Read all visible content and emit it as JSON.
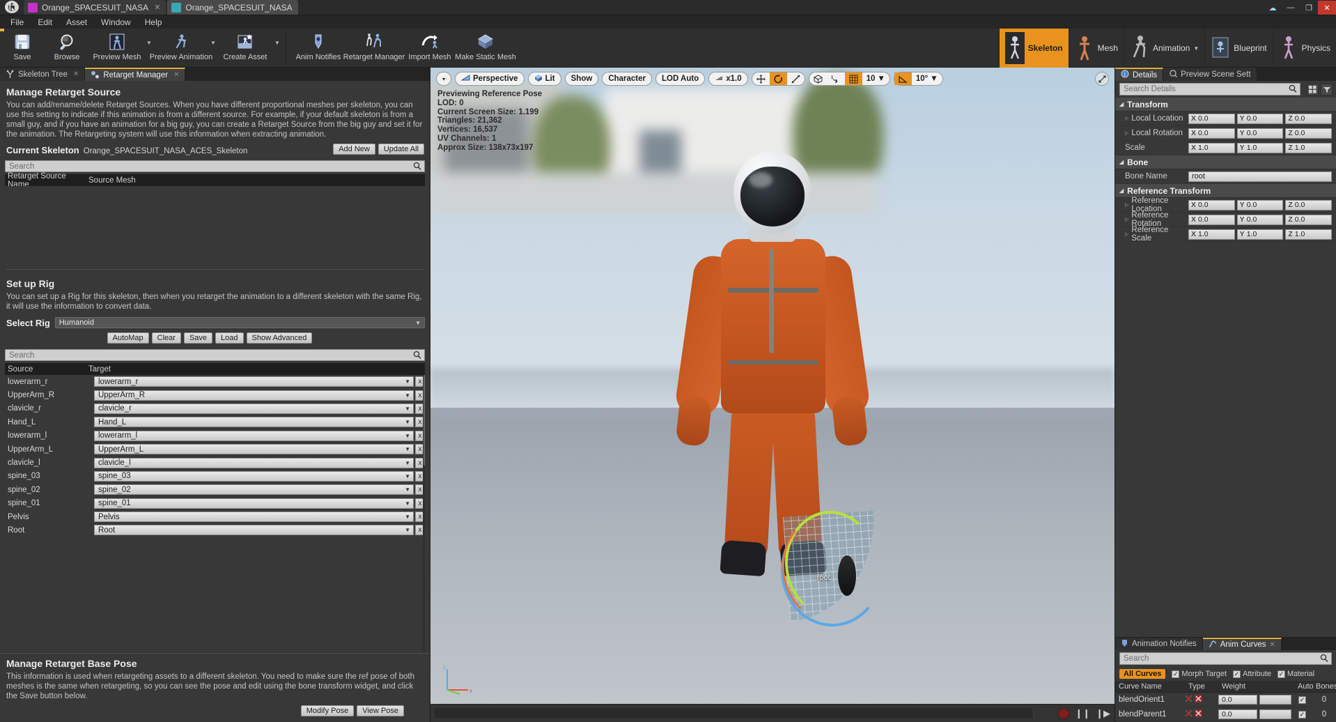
{
  "window": {
    "tabs": [
      {
        "label": "Orange_SPACESUIT_NASA",
        "icon": "skeleton-asset-icon",
        "active": false,
        "color": "#c930c9"
      },
      {
        "label": "Orange_SPACESUIT_NASA",
        "icon": "skeleton-asset-icon",
        "active": true,
        "color": "#3aa7b5"
      }
    ],
    "controls": {
      "minimize": "—",
      "maximize": "❐",
      "close": "✕",
      "extra": "☁"
    }
  },
  "menu": {
    "items": [
      "File",
      "Edit",
      "Asset",
      "Window",
      "Help"
    ]
  },
  "toolbar": {
    "groups": [
      {
        "buttons": [
          {
            "label": "Save",
            "icon": "save-icon",
            "caret": false
          },
          {
            "label": "Browse",
            "icon": "browse-magnifier-icon",
            "caret": false
          },
          {
            "label": "Preview Mesh",
            "icon": "preview-mesh-icon",
            "caret": true
          },
          {
            "label": "Preview Animation",
            "icon": "preview-animation-icon",
            "caret": true
          },
          {
            "label": "Create Asset",
            "icon": "create-asset-icon",
            "caret": true
          }
        ]
      },
      {
        "buttons": [
          {
            "label": "Anim Notifies",
            "icon": "anim-notifies-icon",
            "caret": false
          },
          {
            "label": "Retarget Manager",
            "icon": "retarget-manager-icon",
            "caret": false
          },
          {
            "label": "Import Mesh",
            "icon": "import-mesh-icon",
            "caret": false
          },
          {
            "label": "Make Static Mesh",
            "icon": "make-static-mesh-icon",
            "caret": false
          }
        ]
      }
    ],
    "modes": [
      {
        "label": "Skeleton",
        "icon": "skeleton-mode-icon",
        "active": true,
        "caret": false
      },
      {
        "label": "Mesh",
        "icon": "mesh-mode-icon",
        "active": false,
        "caret": false
      },
      {
        "label": "Animation",
        "icon": "animation-mode-icon",
        "active": false,
        "caret": true
      },
      {
        "label": "Blueprint",
        "icon": "blueprint-mode-icon",
        "active": false,
        "caret": false
      },
      {
        "label": "Physics",
        "icon": "physics-mode-icon",
        "active": false,
        "caret": false
      }
    ]
  },
  "left_panel": {
    "tabs": [
      {
        "label": "Skeleton Tree",
        "icon": "skeleton-tree-icon",
        "active": false,
        "closable": true
      },
      {
        "label": "Retarget Manager",
        "icon": "retarget-manager-tab-icon",
        "active": true,
        "closable": true
      }
    ],
    "manage_retarget_source": {
      "title": "Manage Retarget Source",
      "description": "You can add/rename/delete Retarget Sources. When you have different proportional meshes per skeleton, you can use this setting to indicate if this animation is from a different source. For example, if your default skeleton is from a small guy, and if you have an animation for a big guy, you can create a Retarget Source from the big guy and set it for the animation. The Retargeting system will use this information when extracting animation.",
      "current_skeleton_label": "Current Skeleton",
      "current_skeleton_value": "Orange_SPACESUIT_NASA_ACES_Skeleton",
      "add_new_label": "Add New",
      "update_all_label": "Update All",
      "search_placeholder": "Search",
      "columns": [
        "Retarget Source Name",
        "Source Mesh"
      ],
      "rows": []
    },
    "set_up_rig": {
      "title": "Set up Rig",
      "description": "You can set up a Rig for this skeleton, then when you retarget the animation to a different skeleton with the same Rig, it will use the information to convert data.",
      "select_rig_label": "Select Rig",
      "select_rig_value": "Humanoid",
      "buttons": [
        "AutoMap",
        "Clear",
        "Save",
        "Load",
        "Show Advanced"
      ],
      "search_placeholder": "Search",
      "columns": [
        "Source",
        "Target"
      ],
      "mappings": [
        {
          "source": "Root",
          "target": "Root"
        },
        {
          "source": "Pelvis",
          "target": "Pelvis"
        },
        {
          "source": "spine_01",
          "target": "spine_01"
        },
        {
          "source": "spine_02",
          "target": "spine_02"
        },
        {
          "source": "spine_03",
          "target": "spine_03"
        },
        {
          "source": "clavicle_l",
          "target": "clavicle_l"
        },
        {
          "source": "UpperArm_L",
          "target": "UpperArm_L"
        },
        {
          "source": "lowerarm_l",
          "target": "lowerarm_l"
        },
        {
          "source": "Hand_L",
          "target": "Hand_L"
        },
        {
          "source": "clavicle_r",
          "target": "clavicle_r"
        },
        {
          "source": "UpperArm_R",
          "target": "UpperArm_R"
        },
        {
          "source": "lowerarm_r",
          "target": "lowerarm_r"
        }
      ],
      "clear_button_label": "x"
    },
    "manage_base_pose": {
      "title": "Manage Retarget Base Pose",
      "description": "This information is used when retargeting assets to a different skeleton. You need to make sure the ref pose of both meshes is the same when retargeting, so you can see the pose and edit using the bone transform widget, and click the Save button below.",
      "buttons": [
        "Modify Pose",
        "View Pose"
      ]
    }
  },
  "viewport": {
    "toolbar": {
      "menu_caret": "▾",
      "perspective": "Perspective",
      "lit": "Lit",
      "show": "Show",
      "character": "Character",
      "lod": "LOD Auto",
      "play_rate": "x1.0",
      "translate_snap_on": false,
      "rotate_snap_on": true,
      "scale_snap_on": false,
      "grid_snap_value": "10",
      "angle_snap_value": "10°",
      "camera_speed_icon": "camera-speed-icon",
      "maximize_icon": "maximize-viewport-icon"
    },
    "stats": {
      "previewing": "Previewing Reference Pose",
      "lod": "LOD: 0",
      "screen_size": "Current Screen Size: 1.199",
      "triangles": "Triangles: 21,362",
      "vertices": "Vertices: 16,537",
      "uv_channels": "UV Channels: 1",
      "approx_size": "Approx Size: 138x73x197"
    },
    "gizmo_label": "root",
    "axis": {
      "x": "x",
      "y": "y",
      "z": "z"
    },
    "transport": {
      "record": "record-button",
      "pause": "❙❙",
      "step": "❙▶"
    }
  },
  "right_panel": {
    "tabs": [
      {
        "label": "Details",
        "icon": "details-icon",
        "active": true
      },
      {
        "label": "Preview Scene Sett",
        "icon": "preview-scene-icon",
        "active": false
      }
    ],
    "search_placeholder": "Search Details",
    "categories": [
      {
        "name": "Transform",
        "rows": [
          {
            "label": "Local Location",
            "type": "vector",
            "expandable": true,
            "values": [
              {
                "axis": "X",
                "value": "0.0"
              },
              {
                "axis": "Y",
                "value": "0.0"
              },
              {
                "axis": "Z",
                "value": "0.0"
              }
            ]
          },
          {
            "label": "Local Rotation",
            "type": "vector",
            "expandable": true,
            "values": [
              {
                "axis": "X",
                "value": "0.0"
              },
              {
                "axis": "Y",
                "value": "0.0"
              },
              {
                "axis": "Z",
                "value": "0.0"
              }
            ]
          },
          {
            "label": "Scale",
            "type": "vector",
            "expandable": false,
            "values": [
              {
                "axis": "X",
                "value": "1.0"
              },
              {
                "axis": "Y",
                "value": "1.0"
              },
              {
                "axis": "Z",
                "value": "1.0"
              }
            ]
          }
        ]
      },
      {
        "name": "Bone",
        "rows": [
          {
            "label": "Bone Name",
            "type": "text",
            "expandable": false,
            "value": "root"
          }
        ]
      },
      {
        "name": "Reference Transform",
        "rows": [
          {
            "label": "Reference Location",
            "type": "vector",
            "expandable": true,
            "values": [
              {
                "axis": "X",
                "value": "0.0"
              },
              {
                "axis": "Y",
                "value": "0.0"
              },
              {
                "axis": "Z",
                "value": "0.0"
              }
            ]
          },
          {
            "label": "Reference Rotation",
            "type": "vector",
            "expandable": true,
            "values": [
              {
                "axis": "X",
                "value": "0.0"
              },
              {
                "axis": "Y",
                "value": "0.0"
              },
              {
                "axis": "Z",
                "value": "0.0"
              }
            ]
          },
          {
            "label": "Reference Scale",
            "type": "vector",
            "expandable": true,
            "values": [
              {
                "axis": "X",
                "value": "1.0"
              },
              {
                "axis": "Y",
                "value": "1.0"
              },
              {
                "axis": "Z",
                "value": "1.0"
              }
            ]
          }
        ]
      }
    ],
    "curves": {
      "tabs": [
        {
          "label": "Animation Notifies",
          "icon": "anim-notifies-tab-icon",
          "active": false,
          "closable": false
        },
        {
          "label": "Anim Curves",
          "icon": "anim-curves-tab-icon",
          "active": true,
          "closable": true
        }
      ],
      "search_placeholder": "Search",
      "filters": [
        {
          "label": "All Curves",
          "type": "pill",
          "checked": true
        },
        {
          "label": "Morph Target",
          "type": "checkbox",
          "checked": true
        },
        {
          "label": "Attribute",
          "type": "checkbox",
          "checked": true
        },
        {
          "label": "Material",
          "type": "checkbox",
          "checked": true
        }
      ],
      "columns": [
        "Curve Name",
        "Type",
        "Weight",
        "Auto",
        "Bones"
      ],
      "rows": [
        {
          "name": "blendOrient1",
          "weight": "0.0",
          "auto": true,
          "bones": "0"
        },
        {
          "name": "blendParent1",
          "weight": "0.0",
          "auto": true,
          "bones": "0"
        }
      ]
    }
  },
  "colors": {
    "accent": "#e8931f",
    "tab_highlight": "#e0b23c",
    "panel_bg": "#383838",
    "suit": "#c8561f"
  }
}
